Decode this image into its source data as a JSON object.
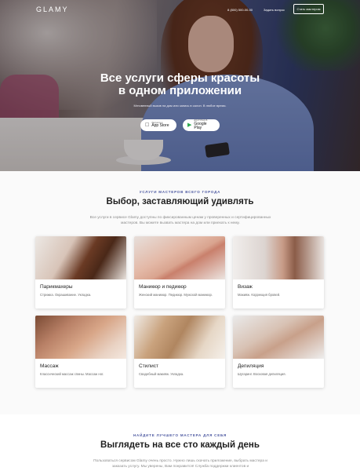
{
  "nav": {
    "logo": "GLAMY",
    "phone": "8 (800) 500-00-00",
    "ask_label": "Задать вопрос",
    "become_master_label": "Стать мастером"
  },
  "hero": {
    "title_line1": "Все услуги сферы красоты",
    "title_line2": "в одном приложении",
    "subtitle": "Мгновенный вызов на дом или запись в салон. В любое время.",
    "app_store": {
      "small": "Загрузите в",
      "big": "App Store",
      "icon": "apple-icon"
    },
    "google_play": {
      "small": "ДОСТУПНО В",
      "big": "Google Play",
      "icon": "play-icon"
    }
  },
  "services_section": {
    "eyebrow": "УСЛУГИ МАСТЕРОВ ВСЕГО ГОРОДА",
    "title": "Выбор, заставляющий удивлять",
    "description": "Все услуги в сервисе Glamy доступны по фиксированным ценам у проверенных и сертифицированных мастеров. Вы можете вызвать мастера на дом или приехать к нему.",
    "cards": [
      {
        "name": "Парикмахеры",
        "desc": "Стрижка. Окрашивание. Укладка."
      },
      {
        "name": "Маникюр и педикюр",
        "desc": "Женский маникюр. Педикюр. Мужской маникюр."
      },
      {
        "name": "Визаж",
        "desc": "Макияж. Коррекция бровей."
      },
      {
        "name": "Массаж",
        "desc": "Классический массаж спины. Массаж ног."
      },
      {
        "name": "Стилист",
        "desc": "Свадебный макияж. Укладка."
      },
      {
        "name": "Депиляция",
        "desc": "Шугаринг. Восковая депиляция."
      }
    ]
  },
  "masters_section": {
    "eyebrow": "НАЙДИТЕ ЛУЧШЕГО МАСТЕРА ДЛЯ СЕБЯ",
    "title": "Выглядеть на все сто каждый день",
    "description": "Пользоваться сервисом Glamy очень просто. Нужно лишь скачать приложение, выбрать мастера и заказать услугу. Мы уверены, Вам понравится! Служба поддержки клиентов и"
  }
}
